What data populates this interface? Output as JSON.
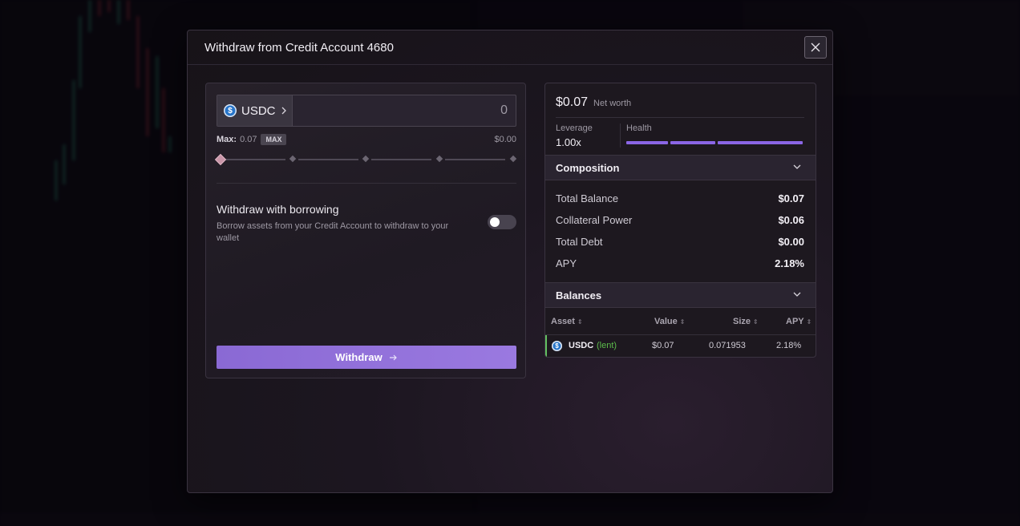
{
  "modal": {
    "title": "Withdraw from Credit Account 4680"
  },
  "asset_input": {
    "asset": "USDC",
    "amount": "0",
    "max_label": "Max:",
    "max_value": "0.07",
    "max_button": "MAX",
    "usd_value": "$0.00",
    "slider_fraction": 0
  },
  "borrowing": {
    "title": "Withdraw with borrowing",
    "description": "Borrow assets from your Credit Account to withdraw to your wallet",
    "enabled": false
  },
  "withdraw_button": "Withdraw",
  "summary": {
    "net_worth_value": "$0.07",
    "net_worth_label": "Net worth",
    "leverage_label": "Leverage",
    "leverage_value": "1.00x",
    "health_label": "Health",
    "health_fraction": 1.0
  },
  "composition": {
    "title": "Composition",
    "rows": [
      {
        "label": "Total Balance",
        "value": "$0.07"
      },
      {
        "label": "Collateral Power",
        "value": "$0.06"
      },
      {
        "label": "Total Debt",
        "value": "$0.00"
      },
      {
        "label": "APY",
        "value": "2.18%"
      }
    ]
  },
  "balances": {
    "title": "Balances",
    "columns": [
      "Asset",
      "Value",
      "Size",
      "APY"
    ],
    "rows": [
      {
        "asset": "USDC",
        "tag": "(lent)",
        "value": "$0.07",
        "size": "0.071953",
        "apy": "2.18%"
      }
    ]
  },
  "colors": {
    "accent": "#8b66e6",
    "lent_green": "#5cbc4b",
    "usdc_blue": "#2775ca"
  }
}
